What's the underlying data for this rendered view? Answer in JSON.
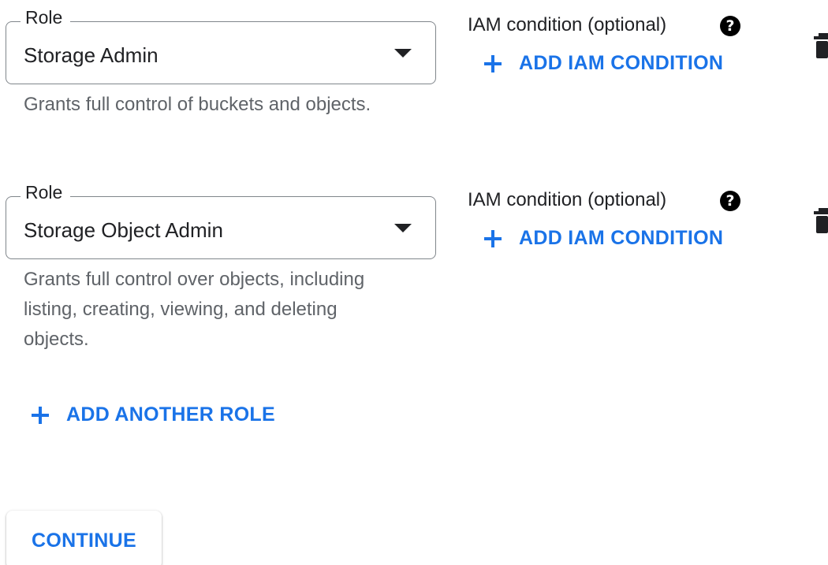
{
  "roles": [
    {
      "legend": "Role",
      "value": "Storage Admin",
      "description": "Grants full control of buckets and objects.",
      "condition_label": "IAM condition (optional)",
      "add_condition_label": "ADD IAM CONDITION"
    },
    {
      "legend": "Role",
      "value": "Storage Object Admin",
      "description": "Grants full control over objects, including listing, creating, viewing, and deleting objects.",
      "condition_label": "IAM condition (optional)",
      "add_condition_label": "ADD IAM CONDITION"
    }
  ],
  "help_icon_glyph": "?",
  "add_role_label": "ADD ANOTHER ROLE",
  "continue_label": "CONTINUE",
  "icons": {
    "help": "help-circle-icon",
    "plus": "plus-icon",
    "delete": "trash-icon",
    "dropdown": "dropdown-arrow-icon"
  },
  "colors": {
    "accent": "#1a73e8",
    "text": "#202124",
    "secondary_text": "#5f6368",
    "border": "#80868b"
  }
}
